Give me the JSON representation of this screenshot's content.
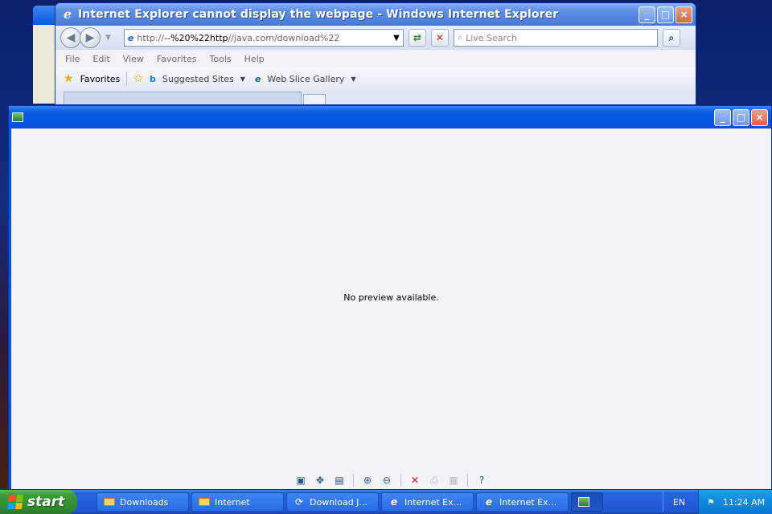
{
  "ie": {
    "title": "Internet Explorer cannot display the webpage - Windows Internet Explorer",
    "address_prefix": "http://",
    "address_main": "--%20%22http",
    "address_suffix": "//java.com/download%22",
    "search_placeholder": "Live Search",
    "menu": [
      "File",
      "Edit",
      "View",
      "Favorites",
      "Tools",
      "Help"
    ],
    "favorites_label": "Favorites",
    "suggested_sites": "Suggested Sites",
    "web_slice_gallery": "Web Slice Gallery"
  },
  "viewer": {
    "message": "No preview available."
  },
  "taskbar": {
    "start_label": "start",
    "tasks": [
      {
        "label": "Downloads",
        "icon": "folder-icon"
      },
      {
        "label": "Internet",
        "icon": "folder-icon"
      },
      {
        "label": "Download J...",
        "icon": "download-icon"
      },
      {
        "label": "Internet Ex...",
        "icon": "ie-icon"
      },
      {
        "label": "Internet Ex...",
        "icon": "ie-icon"
      }
    ],
    "language": "EN",
    "clock": "11:24 AM"
  },
  "colors": {
    "taskbar_blue": "#245edb",
    "start_green": "#318b2f",
    "title_blue": "#0655e0"
  }
}
